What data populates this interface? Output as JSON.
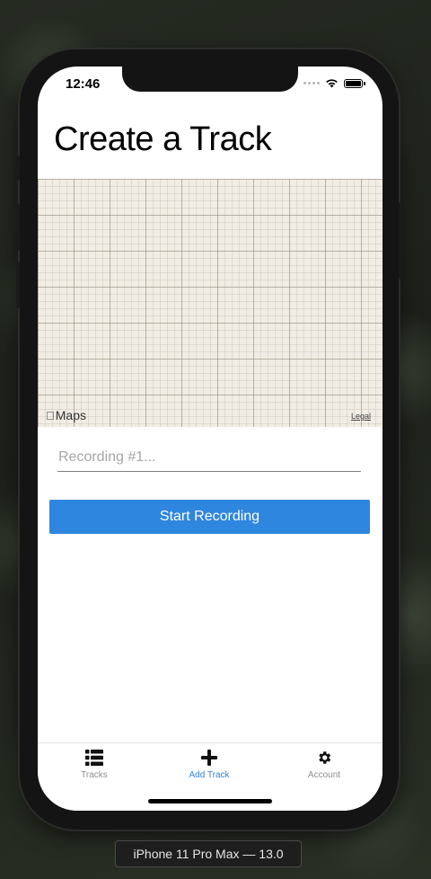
{
  "status_bar": {
    "time": "12:46"
  },
  "page": {
    "title": "Create a Track"
  },
  "map": {
    "brand": "Maps",
    "legal": "Legal"
  },
  "form": {
    "name_placeholder": "Recording #1...",
    "name_value": "",
    "start_label": "Start Recording"
  },
  "tabs": [
    {
      "label": "Tracks",
      "icon": "list-icon",
      "active": false
    },
    {
      "label": "Add Track",
      "icon": "plus-icon",
      "active": true
    },
    {
      "label": "Account",
      "icon": "gear-icon",
      "active": false
    }
  ],
  "device_label": "iPhone 11 Pro Max — 13.0",
  "colors": {
    "accent": "#2f86de",
    "tab_inactive": "#8e8e93",
    "map_background": "#f1ede5"
  }
}
